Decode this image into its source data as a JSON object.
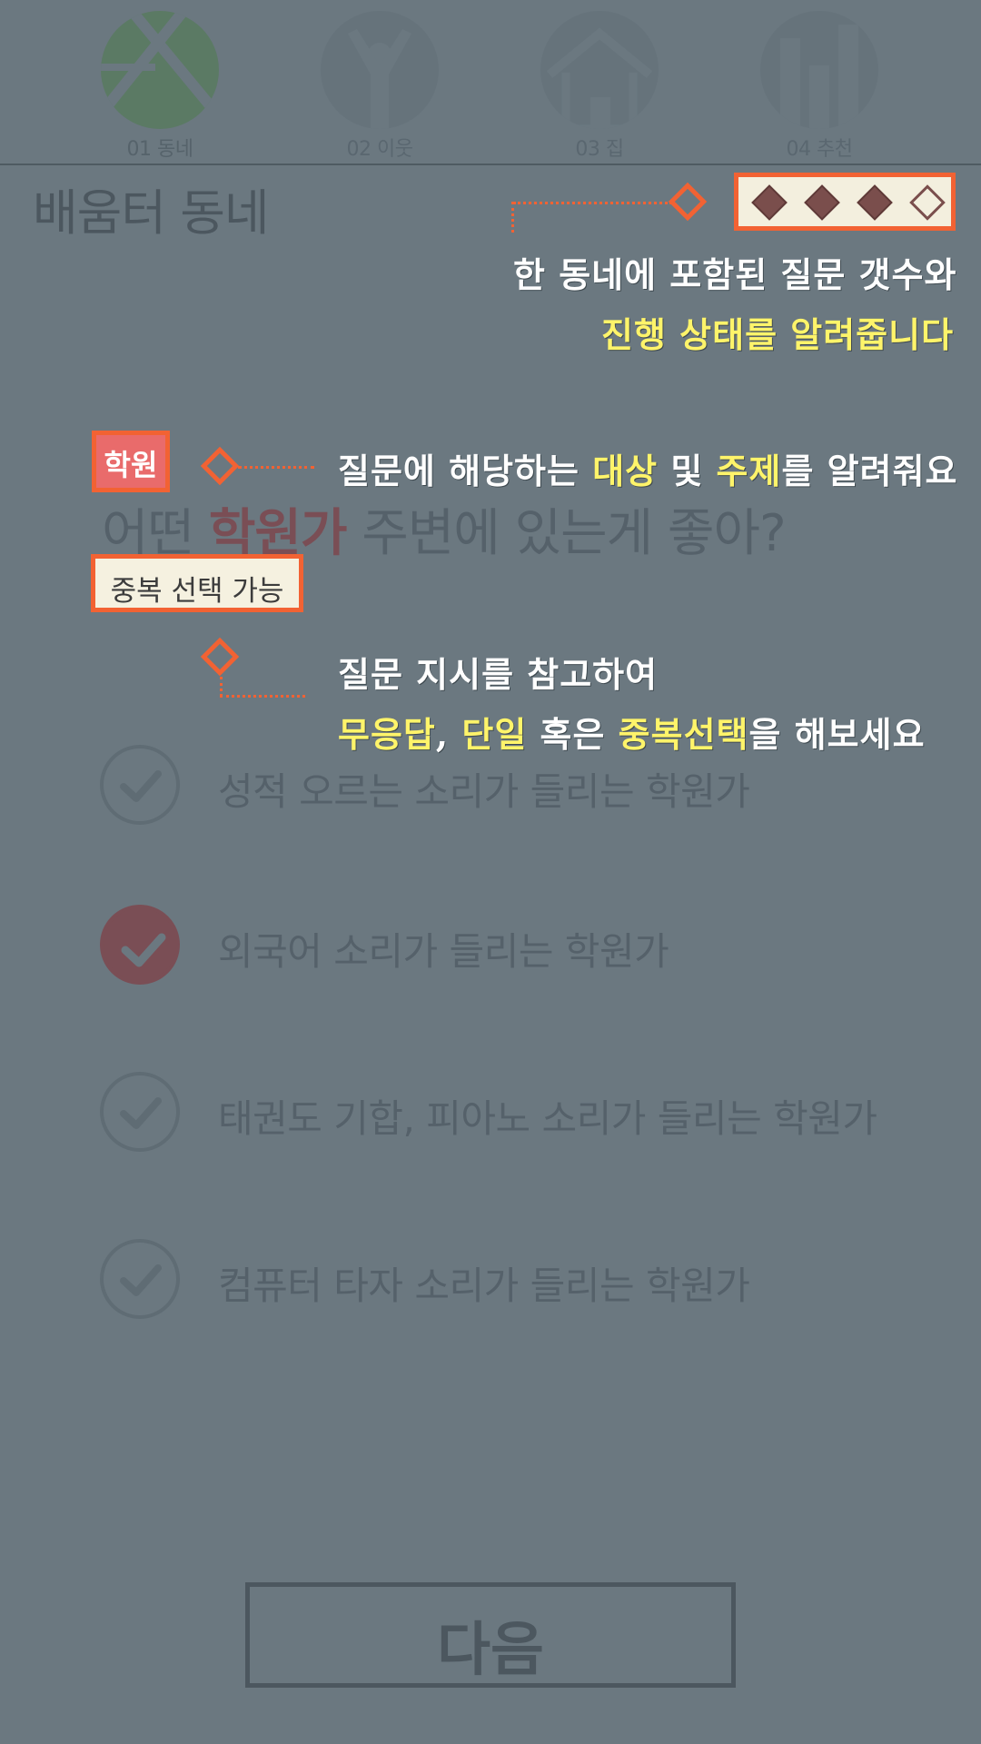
{
  "steps": [
    {
      "label": "01 동네",
      "icon": "neighborhood-map-icon",
      "active": true
    },
    {
      "label": "02 이웃",
      "icon": "person-cheering-icon",
      "active": false
    },
    {
      "label": "03 집",
      "icon": "house-icon",
      "active": false
    },
    {
      "label": "04 추천",
      "icon": "bar-chart-icon",
      "active": false
    }
  ],
  "page_title": "배움터 동네",
  "progress": {
    "total": 4,
    "completed": 3
  },
  "annotations": {
    "progress_note_line1": "한 동네에 포함된 질문 갯수와",
    "progress_note_line2": "진행 상태를 알려줍니다",
    "topic_note_pre": "질문에 해당하는 ",
    "topic_note_hl1": "대상",
    "topic_note_mid": " 및 ",
    "topic_note_hl2": "주제",
    "topic_note_post": "를 알려줘요",
    "instr_note_line1": "질문 지시를 참고하여",
    "instr_note_hl1": "무응답",
    "instr_note_mid1": ", ",
    "instr_note_hl2": "단일",
    "instr_note_mid2": " 혹은 ",
    "instr_note_hl3": "중복선택",
    "instr_note_post": "을 해보세요"
  },
  "question": {
    "tag": "학원",
    "prefix": "어떤 ",
    "highlight": "학원가",
    "suffix": " 주변에 있는게 좋아?",
    "instruction": "중복 선택 가능"
  },
  "options": [
    {
      "text": "성적 오르는 소리가 들리는 학원가",
      "selected": false
    },
    {
      "text": "외국어 소리가 들리는 학원가",
      "selected": true
    },
    {
      "text": "태권도 기합, 피아노 소리가 들리는 학원가",
      "selected": false
    },
    {
      "text": "컴퓨터 타자 소리가 들리는 학원가",
      "selected": false
    }
  ],
  "next_button": "다음",
  "colors": {
    "accent": "#f26233",
    "selected": "#7a4e55",
    "highlight_text": "#fff46a"
  }
}
